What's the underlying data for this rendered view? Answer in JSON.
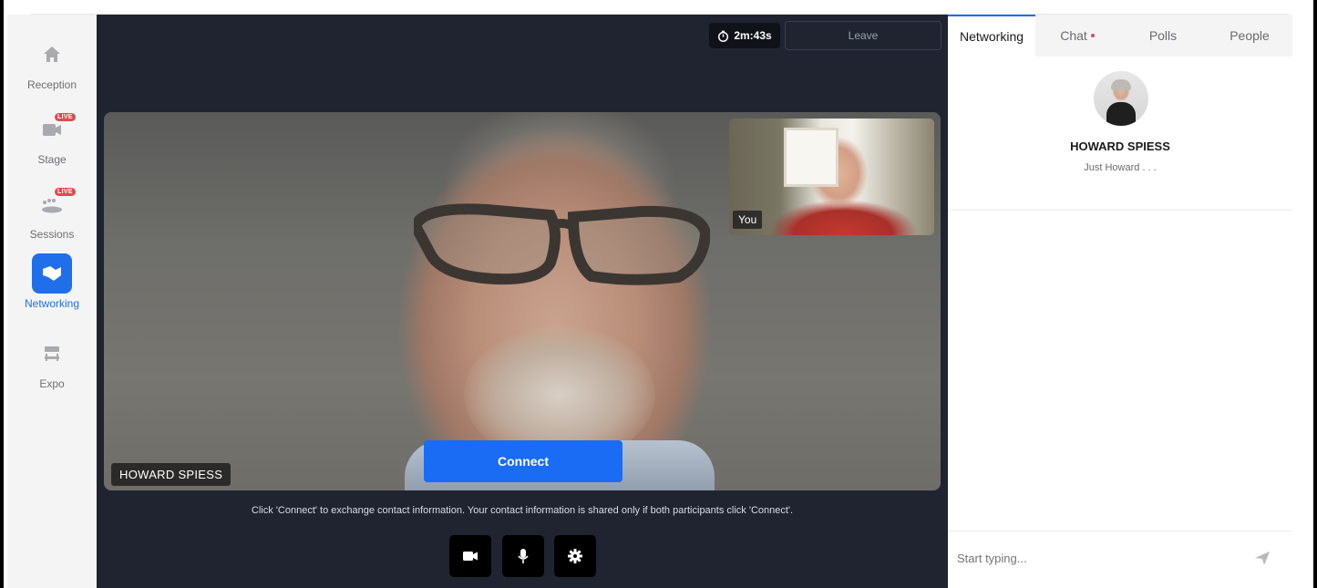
{
  "sidebar": {
    "items": [
      {
        "label": "Reception",
        "icon": "home-icon",
        "live": false
      },
      {
        "label": "Stage",
        "icon": "video-camera-icon",
        "live": true
      },
      {
        "label": "Sessions",
        "icon": "sessions-icon",
        "live": true
      },
      {
        "label": "Networking",
        "icon": "handshake-icon",
        "live": false,
        "active": true
      },
      {
        "label": "Expo",
        "icon": "booth-icon",
        "live": false
      }
    ],
    "live_badge": "LIVE"
  },
  "stage": {
    "timer": "2m:43s",
    "leave_label": "Leave",
    "remote_name": "HOWARD SPIESS",
    "self_label": "You",
    "connect_label": "Connect",
    "hint": "Click 'Connect' to exchange contact information. Your contact information is shared only if both participants click 'Connect'.",
    "controls": [
      "video-camera-icon",
      "microphone-icon",
      "settings-icon"
    ]
  },
  "panel": {
    "tabs": [
      {
        "label": "Networking",
        "active": true
      },
      {
        "label": "Chat",
        "unread_dot": true
      },
      {
        "label": "Polls"
      },
      {
        "label": "People"
      }
    ],
    "profile": {
      "name": "HOWARD SPIESS",
      "tagline": "Just Howard . . ."
    },
    "chat_placeholder": "Start typing..."
  },
  "colors": {
    "accent": "#1f6feb",
    "connect": "#1a6cf5",
    "stage_bg": "#1f2430",
    "live_red": "#e5484d"
  }
}
